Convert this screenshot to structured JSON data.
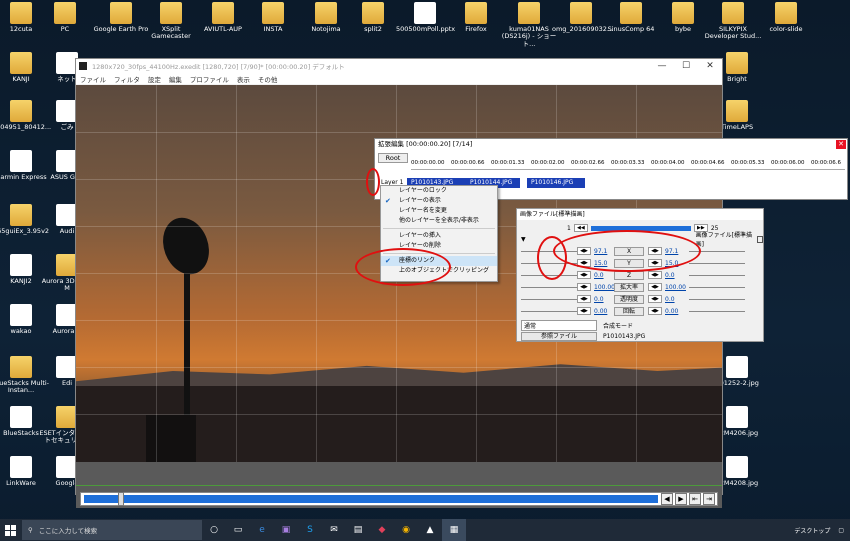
{
  "desktop_icons_top": [
    {
      "label": "12cuta",
      "kind": "folder"
    },
    {
      "label": "PC",
      "kind": "pc"
    },
    {
      "label": "Google Earth Pro",
      "kind": "app"
    },
    {
      "label": "XSplit Gamecaster",
      "kind": "app"
    },
    {
      "label": "AVIUTL-AUP",
      "kind": "folder"
    },
    {
      "label": "INSTA",
      "kind": "folder"
    },
    {
      "label": "Notojima",
      "kind": "folder"
    },
    {
      "label": "split2",
      "kind": "folder"
    },
    {
      "label": "500500mPoll.pptx",
      "kind": "doc"
    },
    {
      "label": "Firefox",
      "kind": "app"
    },
    {
      "label": "kuma01NAS (DS216j) - ショート...",
      "kind": "app"
    },
    {
      "label": "omg_201609032...",
      "kind": "img"
    },
    {
      "label": "SinusComp 64",
      "kind": "app"
    },
    {
      "label": "bybe",
      "kind": "folder"
    },
    {
      "label": "SILKYPIX Developer Stud...",
      "kind": "app"
    },
    {
      "label": "color-slide",
      "kind": "folder"
    }
  ],
  "desktop_icons_left": [
    {
      "label": "KANJI"
    },
    {
      "label": "ネット"
    },
    {
      "label": "ごみ"
    },
    {
      "label": "0904951_80412..."
    },
    {
      "label": "Garmin Express"
    },
    {
      "label": "ASUS GPU"
    },
    {
      "label": "265guiEx_3.95v2"
    },
    {
      "label": "Audi"
    },
    {
      "label": "KANJI2"
    },
    {
      "label": "Aurora 3D Logo M"
    },
    {
      "label": "wakao"
    },
    {
      "label": "Aurora H"
    },
    {
      "label": "BlueStacks Multi-Instan..."
    },
    {
      "label": "Edi"
    },
    {
      "label": "BlueStacks"
    },
    {
      "label": "ESETインターネットセキュリティ"
    },
    {
      "label": "LinkWare"
    },
    {
      "label": "Google"
    }
  ],
  "desktop_icons_right": [
    {
      "label": "Bright"
    },
    {
      "label": "TimeLAPS"
    },
    {
      "label": "C01252-2.jpg"
    },
    {
      "label": "P2M4206.jpg"
    },
    {
      "label": "P2M4208.jpg"
    }
  ],
  "main_window": {
    "title": "1280x720_30fps_44100Hz.exedit [1280,720]  [7/90]* [00:00:00.20]  デフォルト",
    "menu": [
      "ファイル",
      "フィルタ",
      "設定",
      "編集",
      "プロファイル",
      "表示",
      "その他"
    ],
    "controls": [
      "—",
      "☐",
      "✕"
    ]
  },
  "extended_edit": {
    "title": "拡張編集 [00:00:00.20] [7/14]",
    "root_label": "Root",
    "ruler_ticks": [
      "00:00:00.00",
      "00:00:00.66",
      "00:00:01.33",
      "00:00:02.00",
      "00:00:02.66",
      "00:00:03.33",
      "00:00:04.00",
      "00:00:04.66",
      "00:00:05.33",
      "00:00:06.00",
      "00:00:06.6"
    ],
    "layer_label": "Layer 1",
    "clips": [
      "P1010143.JPG",
      "P1010144.JPG",
      "P1010146.JPG"
    ]
  },
  "context_menu": {
    "items": [
      {
        "label": "レイヤーのロック",
        "checked": false
      },
      {
        "label": "レイヤーの表示",
        "checked": true
      },
      {
        "label": "レイヤー名を変更",
        "checked": false
      },
      {
        "label": "他のレイヤーを全表示/非表示",
        "checked": false
      },
      {
        "sep": true
      },
      {
        "label": "レイヤーの挿入",
        "checked": false
      },
      {
        "label": "レイヤーの削除",
        "checked": false
      },
      {
        "sep": true
      },
      {
        "label": "座標のリンク",
        "checked": true,
        "highlight": true
      },
      {
        "label": "上のオブジェクトでクリッピング",
        "checked": false
      }
    ]
  },
  "property_window": {
    "title": "画像ファイル[標準描画]",
    "frame_start": "1",
    "frame_end": "25",
    "object_label": "画像ファイル[標準描画]",
    "params": [
      {
        "left": "97.1",
        "name": "X",
        "right": "97.1"
      },
      {
        "left": "15.0",
        "name": "Y",
        "right": "15.0"
      },
      {
        "left": "0.0",
        "name": "Z",
        "right": "0.0"
      },
      {
        "left": "100.00",
        "name": "拡大率",
        "right": "100.00"
      },
      {
        "left": "0.0",
        "name": "透明度",
        "right": "0.0"
      },
      {
        "left": "0.00",
        "name": "回転",
        "right": "0.00"
      }
    ],
    "blend_mode": "通常",
    "blend_label": "合成モード",
    "ref_button": "参照ファイル",
    "filename": "P1010143.JPG"
  },
  "taskbar": {
    "search_placeholder": "ここに入力して検索",
    "right_label": "デスクトップ"
  },
  "colors": {
    "annotation": "#e01010",
    "clip": "#1b3fb5",
    "seek": "#1e6fd9"
  }
}
